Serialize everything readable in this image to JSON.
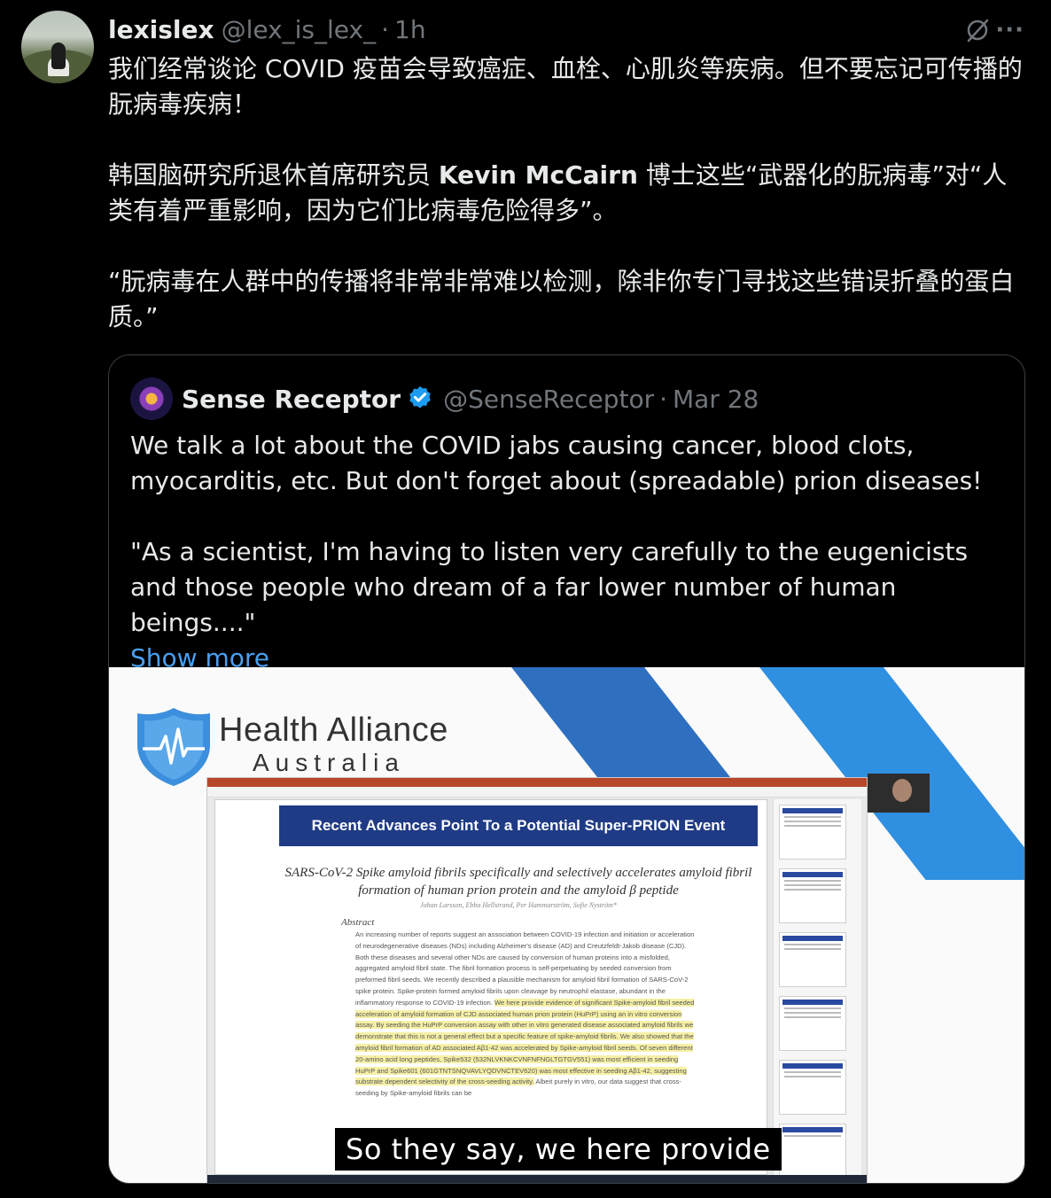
{
  "tweet": {
    "display_name": "lexislex",
    "handle": "@lex_is_lex_",
    "separator": "·",
    "time": "1h",
    "paragraphs": [
      "我们经常谈论 COVID 疫苗会导致癌症、血栓、心肌炎等疾病。但不要忘记可传播的朊病毒疾病！",
      "韩国脑研究所退休首席研究员",
      "Kevin McCairn",
      "博士这些“武器化的朊病毒”对“人类有着严重影响，因为它们比病毒危险得多”。",
      "“朊病毒在人群中的传播将非常非常难以检测，除非你专门寻找这些错误折叠的蛋白质。”"
    ],
    "icons": [
      "avatar",
      "grok-icon",
      "more-icon"
    ]
  },
  "quote": {
    "display_name": "Sense Receptor",
    "handle": "@SenseReceptor",
    "separator": "·",
    "time": "Mar 28",
    "verified_color": "#1d9bf0",
    "paragraphs": [
      "We talk a lot about the COVID jabs causing cancer, blood clots, myocarditis, etc. But don't forget about (spreadable) prion diseases!",
      "\"As a scientist, I'm having to listen very carefully to the eugenicists and those people who dream of a far lower number of human beings....\""
    ],
    "show_more": "Show more",
    "show_more_color": "#4a9ff0"
  },
  "media": {
    "brand_title": "Health Alliance",
    "brand_sub": "Australia",
    "slide_title": "Recent Advances Point To a Potential Super-PRION Event",
    "paper_title": "SARS-CoV-2 Spike amyloid fibrils specifically and selectively accelerates amyloid fibril formation of human prion protein and the amyloid β peptide",
    "paper_authors": "Johan Larsson, Ebba Hellstrand, Per Hammarström, Sofie Nyström*",
    "abstract_label": "Abstract",
    "abstract_plain": "An increasing number of reports suggest an association between COVID-19 infection and initiation or acceleration of neurodegenerative diseases (NDs) including Alzheimer's disease (AD) and Creutzfeldt-Jakob disease (CJD). Both these diseases and several other NDs are caused by conversion of human proteins into a misfolded, aggregated amyloid fibril state. The fibril formation process is self-perpetuating by seeded conversion from preformed fibril seeds. We recently described a plausible mechanism for amyloid fibril formation of SARS-CoV-2 spike protein. Spike-protein formed amyloid fibrils upon cleavage by neutrophil elastase, abundant in the inflammatory response to COVID-19 infection.",
    "abstract_highlight": "We here provide evidence of significant Spike-amyloid fibril seeded acceleration of amyloid formation of CJD associated human prion protein (HuPrP) using an in vitro conversion assay. By seeding the HuPrP conversion assay with other in vitro generated disease associated amyloid fibrils we demonstrate that this is not a general effect but a specific feature of spike-amyloid fibrils. We also showed that the amyloid fibril formation of AD associated Aβ1-42 was accelerated by Spike-amyloid fibril seeds. Of seven different 20-amino acid long peptides, Spike532 (532NLVKNKCVNFNFNGLTGTGV551) was most efficient in seeding HuPrP and Spike601 (601GTNTSNQVAVLYQDVNCTEV620) was most effective in seeding Aβ1-42, suggesting substrate dependent selectivity of the cross-seeding activity.",
    "abstract_tail": "Albeit purely in vitro, our data suggest that cross-seeding by Spike-amyloid fibrils can be",
    "subtitle": "So they say, we here provide"
  }
}
